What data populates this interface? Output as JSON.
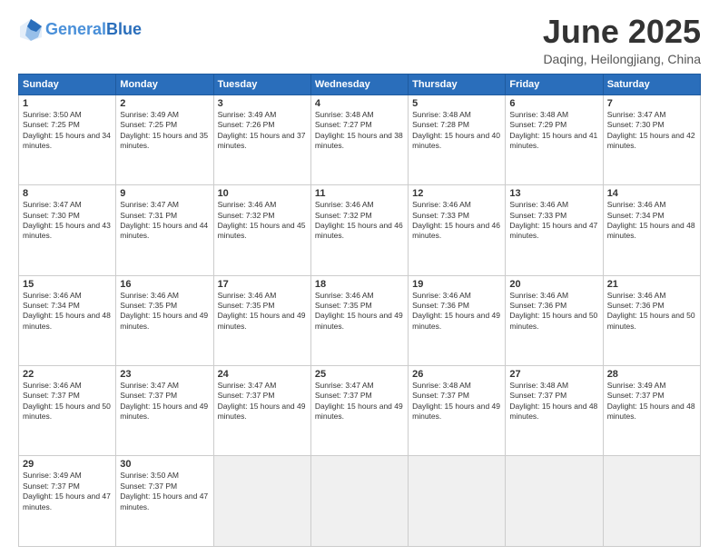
{
  "header": {
    "logo_line1": "General",
    "logo_line2": "Blue",
    "month": "June 2025",
    "location": "Daqing, Heilongjiang, China"
  },
  "weekdays": [
    "Sunday",
    "Monday",
    "Tuesday",
    "Wednesday",
    "Thursday",
    "Friday",
    "Saturday"
  ],
  "weeks": [
    [
      {
        "day": "1",
        "sunrise": "3:50 AM",
        "sunset": "7:25 PM",
        "daylight": "15 hours and 34 minutes."
      },
      {
        "day": "2",
        "sunrise": "3:49 AM",
        "sunset": "7:25 PM",
        "daylight": "15 hours and 35 minutes."
      },
      {
        "day": "3",
        "sunrise": "3:49 AM",
        "sunset": "7:26 PM",
        "daylight": "15 hours and 37 minutes."
      },
      {
        "day": "4",
        "sunrise": "3:48 AM",
        "sunset": "7:27 PM",
        "daylight": "15 hours and 38 minutes."
      },
      {
        "day": "5",
        "sunrise": "3:48 AM",
        "sunset": "7:28 PM",
        "daylight": "15 hours and 40 minutes."
      },
      {
        "day": "6",
        "sunrise": "3:48 AM",
        "sunset": "7:29 PM",
        "daylight": "15 hours and 41 minutes."
      },
      {
        "day": "7",
        "sunrise": "3:47 AM",
        "sunset": "7:30 PM",
        "daylight": "15 hours and 42 minutes."
      }
    ],
    [
      {
        "day": "8",
        "sunrise": "3:47 AM",
        "sunset": "7:30 PM",
        "daylight": "15 hours and 43 minutes."
      },
      {
        "day": "9",
        "sunrise": "3:47 AM",
        "sunset": "7:31 PM",
        "daylight": "15 hours and 44 minutes."
      },
      {
        "day": "10",
        "sunrise": "3:46 AM",
        "sunset": "7:32 PM",
        "daylight": "15 hours and 45 minutes."
      },
      {
        "day": "11",
        "sunrise": "3:46 AM",
        "sunset": "7:32 PM",
        "daylight": "15 hours and 46 minutes."
      },
      {
        "day": "12",
        "sunrise": "3:46 AM",
        "sunset": "7:33 PM",
        "daylight": "15 hours and 46 minutes."
      },
      {
        "day": "13",
        "sunrise": "3:46 AM",
        "sunset": "7:33 PM",
        "daylight": "15 hours and 47 minutes."
      },
      {
        "day": "14",
        "sunrise": "3:46 AM",
        "sunset": "7:34 PM",
        "daylight": "15 hours and 48 minutes."
      }
    ],
    [
      {
        "day": "15",
        "sunrise": "3:46 AM",
        "sunset": "7:34 PM",
        "daylight": "15 hours and 48 minutes."
      },
      {
        "day": "16",
        "sunrise": "3:46 AM",
        "sunset": "7:35 PM",
        "daylight": "15 hours and 49 minutes."
      },
      {
        "day": "17",
        "sunrise": "3:46 AM",
        "sunset": "7:35 PM",
        "daylight": "15 hours and 49 minutes."
      },
      {
        "day": "18",
        "sunrise": "3:46 AM",
        "sunset": "7:35 PM",
        "daylight": "15 hours and 49 minutes."
      },
      {
        "day": "19",
        "sunrise": "3:46 AM",
        "sunset": "7:36 PM",
        "daylight": "15 hours and 49 minutes."
      },
      {
        "day": "20",
        "sunrise": "3:46 AM",
        "sunset": "7:36 PM",
        "daylight": "15 hours and 50 minutes."
      },
      {
        "day": "21",
        "sunrise": "3:46 AM",
        "sunset": "7:36 PM",
        "daylight": "15 hours and 50 minutes."
      }
    ],
    [
      {
        "day": "22",
        "sunrise": "3:46 AM",
        "sunset": "7:37 PM",
        "daylight": "15 hours and 50 minutes."
      },
      {
        "day": "23",
        "sunrise": "3:47 AM",
        "sunset": "7:37 PM",
        "daylight": "15 hours and 49 minutes."
      },
      {
        "day": "24",
        "sunrise": "3:47 AM",
        "sunset": "7:37 PM",
        "daylight": "15 hours and 49 minutes."
      },
      {
        "day": "25",
        "sunrise": "3:47 AM",
        "sunset": "7:37 PM",
        "daylight": "15 hours and 49 minutes."
      },
      {
        "day": "26",
        "sunrise": "3:48 AM",
        "sunset": "7:37 PM",
        "daylight": "15 hours and 49 minutes."
      },
      {
        "day": "27",
        "sunrise": "3:48 AM",
        "sunset": "7:37 PM",
        "daylight": "15 hours and 48 minutes."
      },
      {
        "day": "28",
        "sunrise": "3:49 AM",
        "sunset": "7:37 PM",
        "daylight": "15 hours and 48 minutes."
      }
    ],
    [
      {
        "day": "29",
        "sunrise": "3:49 AM",
        "sunset": "7:37 PM",
        "daylight": "15 hours and 47 minutes."
      },
      {
        "day": "30",
        "sunrise": "3:50 AM",
        "sunset": "7:37 PM",
        "daylight": "15 hours and 47 minutes."
      },
      null,
      null,
      null,
      null,
      null
    ]
  ]
}
